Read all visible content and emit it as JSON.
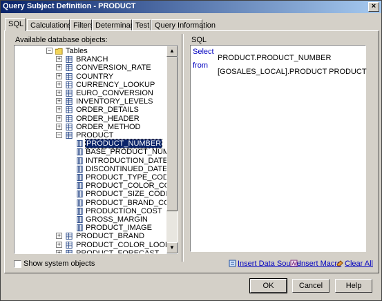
{
  "window": {
    "title": "Query Subject Definition - PRODUCT",
    "close_glyph": "×"
  },
  "tabs": [
    {
      "label": "SQL",
      "active": true
    },
    {
      "label": "Calculations"
    },
    {
      "label": "Filters"
    },
    {
      "label": "Determinants"
    },
    {
      "label": "Test"
    },
    {
      "label": "Query Information"
    }
  ],
  "left": {
    "label": "Available database objects:",
    "tree": {
      "root": "Tables",
      "tables_before": [
        "BRANCH",
        "CONVERSION_RATE",
        "COUNTRY",
        "CURRENCY_LOOKUP",
        "EURO_CONVERSION",
        "INVENTORY_LEVELS",
        "ORDER_DETAILS",
        "ORDER_HEADER",
        "ORDER_METHOD"
      ],
      "expanded_table": "PRODUCT",
      "columns": [
        "PRODUCT_NUMBER",
        "BASE_PRODUCT_NUMBER",
        "INTRODUCTION_DATE",
        "DISCONTINUED_DATE",
        "PRODUCT_TYPE_CODE",
        "PRODUCT_COLOR_CODE",
        "PRODUCT_SIZE_CODE",
        "PRODUCT_BRAND_CODE",
        "PRODUCTION_COST",
        "GROSS_MARGIN",
        "PRODUCT_IMAGE"
      ],
      "selected_column": "PRODUCT_NUMBER",
      "tables_after": [
        "PRODUCT_BRAND",
        "PRODUCT_COLOR_LOOKUP",
        "PRODUCT_FORECAST"
      ]
    },
    "show_system_objects": "Show system objects",
    "show_system_objects_checked": false
  },
  "sql": {
    "label": "SQL",
    "select_keyword": "Select",
    "select_expr": "PRODUCT.PRODUCT_NUMBER",
    "from_keyword": "from",
    "from_expr": "[GOSALES_LOCAL].PRODUCT PRODUCT"
  },
  "actions": {
    "insert_data_source": "Insert Data Source",
    "insert_macro": "Insert Macro",
    "clear_all": "Clear All"
  },
  "buttons": {
    "ok": "OK",
    "cancel": "Cancel",
    "help": "Help"
  },
  "colors": {
    "title_start": "#0a246a",
    "title_end": "#a6caf0",
    "selection": "#0a246a",
    "keyword": "#0000c0",
    "dialog_bg": "#d4d0c8"
  }
}
